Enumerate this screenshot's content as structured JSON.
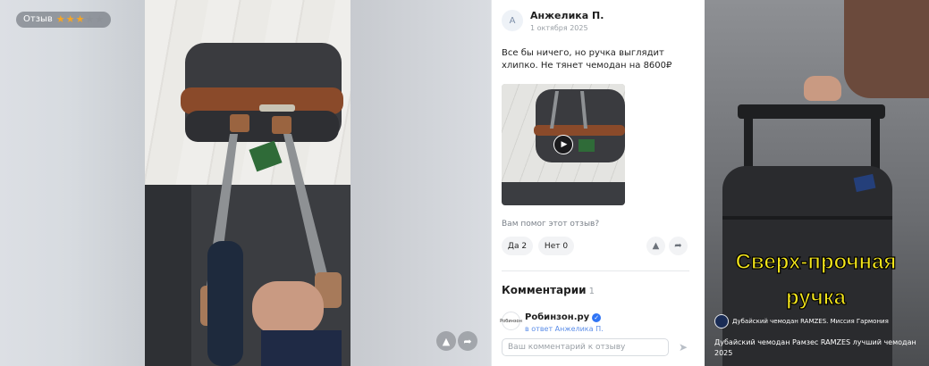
{
  "media": {
    "badge_label": "Отзыв",
    "rating": 3,
    "rating_max": 5,
    "star_color": "#f5a524",
    "star_empty_color": "#8d9198"
  },
  "review": {
    "avatar_letter": "А",
    "author": "Анжелика П.",
    "date": "1 октября 2025",
    "text": "Все бы ничего, но ручка выглядит хлипко. Не тянет чемодан на 8600₽",
    "helpful_question": "Вам помог этот отзыв?",
    "yes_label": "Да 2",
    "no_label": "Нет 0"
  },
  "comments": {
    "title": "Комментарии",
    "count": "1",
    "item": {
      "avatar_text": "Робинзон",
      "author": "Робинзон.ру",
      "reply_to": "в ответ Анжелика П."
    },
    "input_placeholder": "Ваш комментарий к отзыву"
  },
  "video": {
    "overlay_line1": "Сверх-прочная",
    "overlay_line2": "ручка",
    "channel": "Дубайский чемодан RAMZES. Миссия Гармония",
    "title": "Дубайский чемодан Рамзес RAMZES лучший чемодан 2025",
    "overlay_color": "#f4e61b"
  },
  "icons": {
    "report": "warning-icon",
    "share": "share-icon",
    "play": "play-icon",
    "send": "send-icon",
    "verified": "verified-icon"
  }
}
